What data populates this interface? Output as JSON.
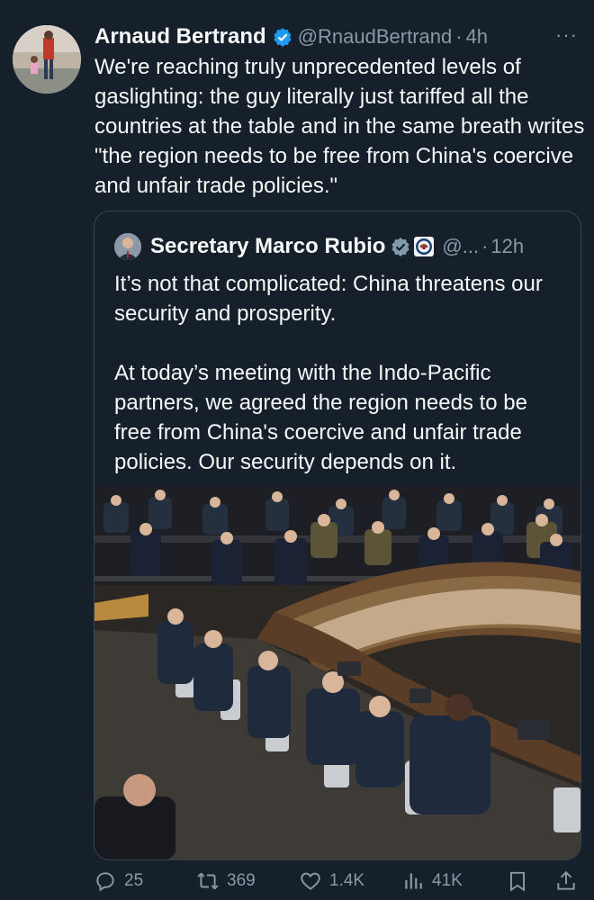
{
  "author": {
    "name": "Arnaud Bertrand",
    "handle": "@RnaudBertrand",
    "separator": "·",
    "time": "4h",
    "more": "···"
  },
  "tweet_text": "We're reaching truly unprecedented levels of gaslighting: the guy literally just tariffed all the countries at the table and in the same breath writes \"the region needs to be free from China's coercive and unfair trade policies.\"",
  "quote": {
    "name": "Secretary Marco Rubio",
    "handle": "@...",
    "separator": "·",
    "time": "12h",
    "text": "It’s not that complicated: China threatens our security and prosperity.\n\nAt today’s meeting with the Indo-Pacific partners, we agreed the region needs to be free from China's coercive and unfair trade policies. Our security depends on it."
  },
  "actions": {
    "replies": "25",
    "reposts": "369",
    "likes": "1.4K",
    "views": "41K"
  },
  "colors": {
    "background": "#15202b",
    "text": "#f7f9f9",
    "secondary": "#8b98a5",
    "border": "#38444d",
    "verified": "#1d9bf0"
  },
  "icons": [
    "verified-badge-icon",
    "seal-icon",
    "more-icon",
    "reply-icon",
    "repost-icon",
    "like-icon",
    "views-icon",
    "bookmark-icon",
    "share-icon"
  ]
}
